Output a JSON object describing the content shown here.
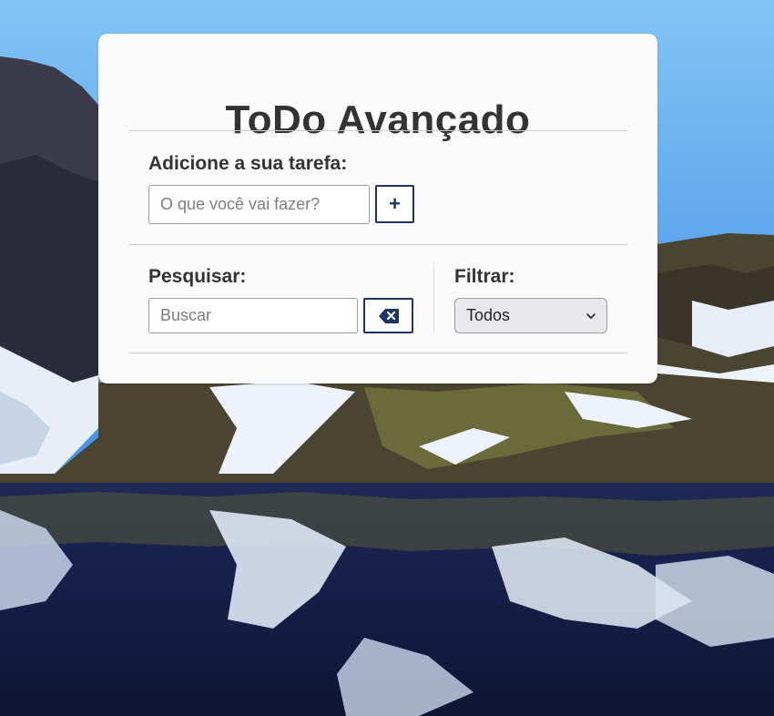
{
  "app": {
    "title": "ToDo Avançado"
  },
  "add_section": {
    "label": "Adicione a sua tarefa:",
    "input_placeholder": "O que você vai fazer?",
    "input_value": "",
    "add_button_icon": "plus-icon",
    "add_button_label": "+"
  },
  "search_section": {
    "label": "Pesquisar:",
    "input_placeholder": "Buscar",
    "input_value": "",
    "clear_button_icon": "backspace-icon"
  },
  "filter_section": {
    "label": "Filtrar:",
    "selected": "Todos",
    "dropdown_icon": "chevron-down-icon"
  },
  "colors": {
    "accent": "#1c3566",
    "card_background": "#fbfbfc",
    "title_text": "#333333"
  }
}
